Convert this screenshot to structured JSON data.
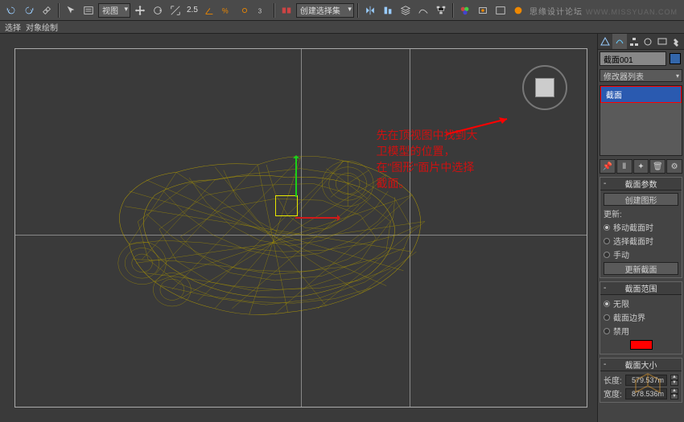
{
  "watermark": {
    "site": "思缘设计论坛",
    "url": "WWW.MISSYUAN.COM"
  },
  "toolbar": {
    "view_dd": "视图",
    "num": "2.5",
    "create_dd": "创建选择集"
  },
  "subbar": {
    "item1": "选择",
    "item2": "对象绘制"
  },
  "annotation": "先在顶视图中找到大卫模型的位置，在\"图形\"面片中选择截面。",
  "sidebar": {
    "object_name": "截面001",
    "modlist_dd": "修改器列表",
    "mod_item": "截面",
    "rollouts": {
      "params": {
        "title": "截面参数",
        "create_btn": "创建图形",
        "update_label": "更新:",
        "r1": "移动截面时",
        "r2": "选择截面时",
        "r3": "手动",
        "update_btn": "更新截面"
      },
      "extent": {
        "title": "截面范围",
        "r1": "无限",
        "r2": "截面边界",
        "r3": "禁用"
      },
      "size": {
        "title": "截面大小",
        "len_label": "长度:",
        "len_val": "579.537m",
        "wid_label": "宽度:",
        "wid_val": "878.536m"
      }
    }
  }
}
